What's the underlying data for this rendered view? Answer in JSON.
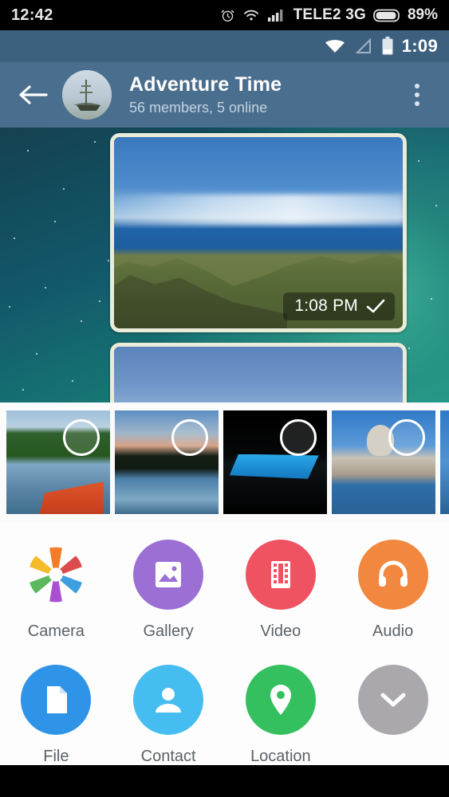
{
  "device_status_bar": {
    "time": "12:42",
    "alarm_icon": "alarm-clock-icon",
    "wifi_icon": "wifi-icon",
    "signal_icon": "cellular-signal-icon",
    "carrier": "TELE2 3G",
    "battery_icon": "battery-icon",
    "battery_percent": "89%"
  },
  "app_status_bar": {
    "wifi_icon": "wifi-icon",
    "signal_icon": "cellular-signal-empty-icon",
    "battery_icon": "battery-icon",
    "time": "1:09"
  },
  "app_bar": {
    "back_icon": "back-arrow-icon",
    "avatar": "group-avatar-ship",
    "title": "Adventure Time",
    "subtitle": "56 members, 5 online",
    "overflow_icon": "overflow-menu-icon",
    "background_color": "#4a6e8e"
  },
  "chat": {
    "wallpaper": "starry-teal-wallpaper",
    "messages": [
      {
        "type": "photo",
        "content": "coastal-cliffs-landscape-photo",
        "time": "1:08 PM",
        "status_icon": "sent-check-icon"
      },
      {
        "type": "photo",
        "content": "blue-sky-photo",
        "time": "",
        "status_icon": ""
      }
    ]
  },
  "photo_picker": {
    "thumbnails": [
      {
        "name": "lake-with-red-boat",
        "selected": false
      },
      {
        "name": "dusk-lake-reflection",
        "selected": false
      },
      {
        "name": "night-pool",
        "selected": false
      },
      {
        "name": "venice-basilica",
        "selected": false
      },
      {
        "name": "blue-water-partial",
        "selected": false
      }
    ],
    "checkbox_icon": "unselected-circle-icon"
  },
  "attachment_menu": {
    "rows": [
      [
        {
          "label": "Camera",
          "icon": "camera-aperture-icon",
          "color": "#ffffff"
        },
        {
          "label": "Gallery",
          "icon": "gallery-image-icon",
          "color": "#9b6fd4"
        },
        {
          "label": "Video",
          "icon": "video-film-icon",
          "color": "#ef5261"
        },
        {
          "label": "Audio",
          "icon": "audio-headphones-icon",
          "color": "#f2883f"
        }
      ],
      [
        {
          "label": "File",
          "icon": "file-document-icon",
          "color": "#2f94e8"
        },
        {
          "label": "Contact",
          "icon": "contact-person-icon",
          "color": "#46bdf0"
        },
        {
          "label": "Location",
          "icon": "location-pin-icon",
          "color": "#34c05f"
        },
        {
          "label": "",
          "icon": "chevron-down-icon",
          "color": "#aaa7ad"
        }
      ]
    ]
  },
  "nav_bar": {
    "color": "#000000"
  }
}
